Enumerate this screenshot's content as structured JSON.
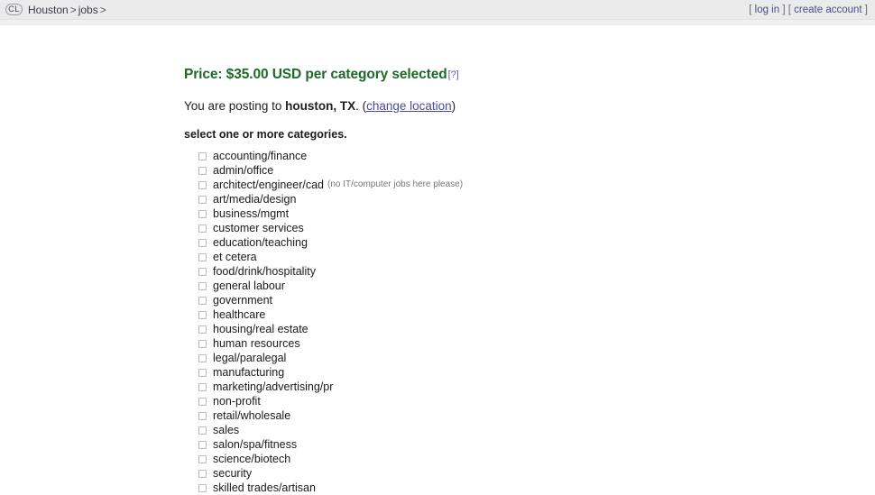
{
  "header": {
    "logo_text": "CL",
    "breadcrumb": [
      {
        "label": "Houston",
        "sep": ">"
      },
      {
        "label": "jobs",
        "sep": ">"
      }
    ],
    "breadcrumb_text": "Houston > jobs >",
    "account": {
      "open_bracket": "[",
      "log_in": "log in",
      "close_bracket": "]",
      "open_bracket2": "[",
      "create_account": "create account",
      "close_bracket2": "]",
      "full_text": "[ log in ] [ create account ]"
    }
  },
  "main": {
    "price_heading": "Price: $35.00 USD per category selected",
    "price_help": "[?]",
    "posting_prefix": "You are posting to ",
    "posting_location": "houston, TX",
    "posting_period": ". (",
    "change_location_label": "change location",
    "posting_suffix": ")",
    "select_instruction": "select one or more categories.",
    "categories": [
      {
        "label": "accounting/finance",
        "note": ""
      },
      {
        "label": "admin/office",
        "note": ""
      },
      {
        "label": "architect/engineer/cad",
        "note": "(no IT/computer jobs here please)"
      },
      {
        "label": "art/media/design",
        "note": ""
      },
      {
        "label": "business/mgmt",
        "note": ""
      },
      {
        "label": "customer services",
        "note": ""
      },
      {
        "label": "education/teaching",
        "note": ""
      },
      {
        "label": "et cetera",
        "note": ""
      },
      {
        "label": "food/drink/hospitality",
        "note": ""
      },
      {
        "label": "general labour",
        "note": ""
      },
      {
        "label": "government",
        "note": ""
      },
      {
        "label": "healthcare",
        "note": ""
      },
      {
        "label": "housing/real estate",
        "note": ""
      },
      {
        "label": "human resources",
        "note": ""
      },
      {
        "label": "legal/paralegal",
        "note": ""
      },
      {
        "label": "manufacturing",
        "note": ""
      },
      {
        "label": "marketing/advertising/pr",
        "note": ""
      },
      {
        "label": "non-profit",
        "note": ""
      },
      {
        "label": "retail/wholesale",
        "note": ""
      },
      {
        "label": "sales",
        "note": ""
      },
      {
        "label": "salon/spa/fitness",
        "note": ""
      },
      {
        "label": "science/biotech",
        "note": ""
      },
      {
        "label": "security",
        "note": ""
      },
      {
        "label": "skilled trades/artisan",
        "note": ""
      }
    ]
  },
  "colors": {
    "header_bg": "#ebebeb",
    "price_green": "#1d6a28",
    "link_purple": "#4a4a9c",
    "page_bg": "#ffffff"
  }
}
